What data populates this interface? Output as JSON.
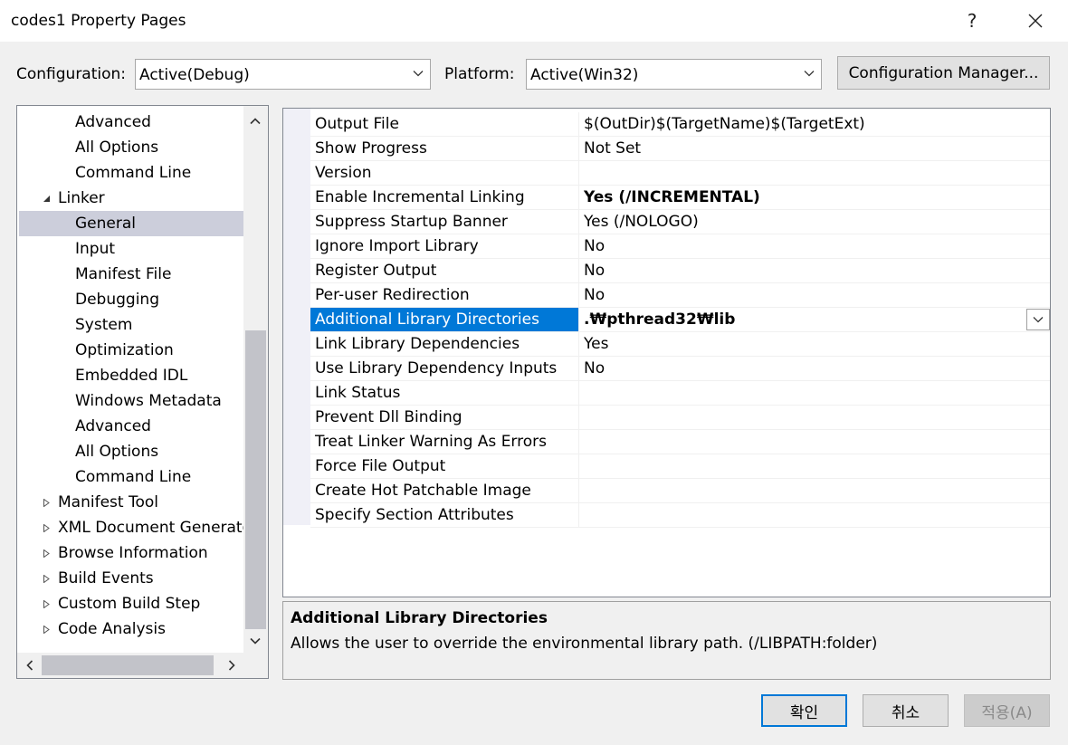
{
  "window": {
    "title": "codes1 Property Pages",
    "help_label": "?",
    "close_label": "✕"
  },
  "config": {
    "configuration_label": "Configuration:",
    "configuration_value": "Active(Debug)",
    "platform_label": "Platform:",
    "platform_value": "Active(Win32)",
    "manager_label": "Configuration Manager..."
  },
  "tree": {
    "items": [
      {
        "label": "Advanced",
        "level": 2,
        "expander": "none",
        "selected": false
      },
      {
        "label": "All Options",
        "level": 2,
        "expander": "none",
        "selected": false
      },
      {
        "label": "Command Line",
        "level": 2,
        "expander": "none",
        "selected": false
      },
      {
        "label": "Linker",
        "level": 1,
        "expander": "expanded",
        "selected": false
      },
      {
        "label": "General",
        "level": 2,
        "expander": "none",
        "selected": true
      },
      {
        "label": "Input",
        "level": 2,
        "expander": "none",
        "selected": false
      },
      {
        "label": "Manifest File",
        "level": 2,
        "expander": "none",
        "selected": false
      },
      {
        "label": "Debugging",
        "level": 2,
        "expander": "none",
        "selected": false
      },
      {
        "label": "System",
        "level": 2,
        "expander": "none",
        "selected": false
      },
      {
        "label": "Optimization",
        "level": 2,
        "expander": "none",
        "selected": false
      },
      {
        "label": "Embedded IDL",
        "level": 2,
        "expander": "none",
        "selected": false
      },
      {
        "label": "Windows Metadata",
        "level": 2,
        "expander": "none",
        "selected": false
      },
      {
        "label": "Advanced",
        "level": 2,
        "expander": "none",
        "selected": false
      },
      {
        "label": "All Options",
        "level": 2,
        "expander": "none",
        "selected": false
      },
      {
        "label": "Command Line",
        "level": 2,
        "expander": "none",
        "selected": false
      },
      {
        "label": "Manifest Tool",
        "level": 1,
        "expander": "collapsed",
        "selected": false
      },
      {
        "label": "XML Document Generato",
        "level": 1,
        "expander": "collapsed",
        "selected": false
      },
      {
        "label": "Browse Information",
        "level": 1,
        "expander": "collapsed",
        "selected": false
      },
      {
        "label": "Build Events",
        "level": 1,
        "expander": "collapsed",
        "selected": false
      },
      {
        "label": "Custom Build Step",
        "level": 1,
        "expander": "collapsed",
        "selected": false
      },
      {
        "label": "Code Analysis",
        "level": 1,
        "expander": "collapsed",
        "selected": false
      }
    ]
  },
  "grid": {
    "rows": [
      {
        "name": "Output File",
        "value": "$(OutDir)$(TargetName)$(TargetExt)",
        "bold": false,
        "selected": false
      },
      {
        "name": "Show Progress",
        "value": "Not Set",
        "bold": false,
        "selected": false
      },
      {
        "name": "Version",
        "value": "",
        "bold": false,
        "selected": false
      },
      {
        "name": "Enable Incremental Linking",
        "value": "Yes (/INCREMENTAL)",
        "bold": true,
        "selected": false
      },
      {
        "name": "Suppress Startup Banner",
        "value": "Yes (/NOLOGO)",
        "bold": false,
        "selected": false
      },
      {
        "name": "Ignore Import Library",
        "value": "No",
        "bold": false,
        "selected": false
      },
      {
        "name": "Register Output",
        "value": "No",
        "bold": false,
        "selected": false
      },
      {
        "name": "Per-user Redirection",
        "value": "No",
        "bold": false,
        "selected": false
      },
      {
        "name": "Additional Library Directories",
        "value": ".₩pthread32₩lib",
        "bold": true,
        "selected": true
      },
      {
        "name": "Link Library Dependencies",
        "value": "Yes",
        "bold": false,
        "selected": false
      },
      {
        "name": "Use Library Dependency Inputs",
        "value": "No",
        "bold": false,
        "selected": false
      },
      {
        "name": "Link Status",
        "value": "",
        "bold": false,
        "selected": false
      },
      {
        "name": "Prevent Dll Binding",
        "value": "",
        "bold": false,
        "selected": false
      },
      {
        "name": "Treat Linker Warning As Errors",
        "value": "",
        "bold": false,
        "selected": false
      },
      {
        "name": "Force File Output",
        "value": "",
        "bold": false,
        "selected": false
      },
      {
        "name": "Create Hot Patchable Image",
        "value": "",
        "bold": false,
        "selected": false
      },
      {
        "name": "Specify Section Attributes",
        "value": "",
        "bold": false,
        "selected": false
      }
    ]
  },
  "description": {
    "title": "Additional Library Directories",
    "text": "Allows the user to override the environmental library path. (/LIBPATH:folder)"
  },
  "buttons": {
    "ok": "확인",
    "cancel": "취소",
    "apply": "적용(A)"
  },
  "colors": {
    "selection_blue": "#0078d7",
    "tree_selection": "#cccedb"
  }
}
